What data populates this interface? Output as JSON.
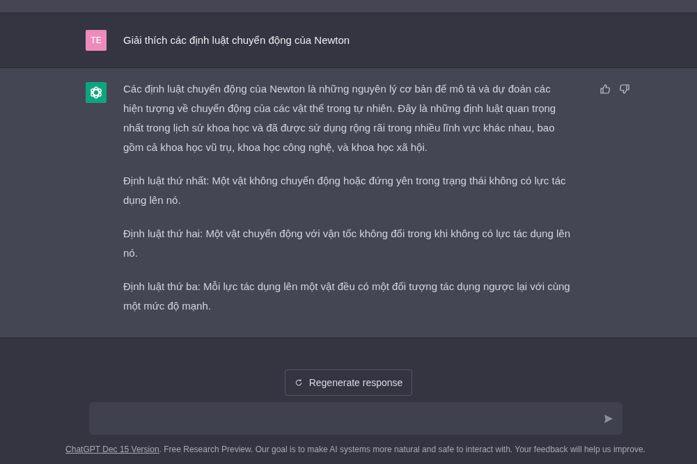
{
  "user_message": {
    "avatar": "TE",
    "text": "Giải thích các định luật chuyển động của Newton"
  },
  "assistant_message": {
    "paragraphs": [
      "Các định luật chuyển động của Newton là những nguyên lý cơ bản để mô tả và dự đoán các hiện tượng về chuyển động của các vật thể trong tự nhiên. Đây là những định luật quan trọng nhất trong lịch sử khoa học và đã được sử dụng rộng rãi trong nhiều lĩnh vực khác nhau, bao gồm cả khoa học vũ trụ, khoa học công nghệ, và khoa học xã hội.",
      "Định luật thứ nhất: Một vật không chuyển động hoặc đứng yên trong trạng thái không có lực tác dụng lên nó.",
      "Định luật thứ hai: Một vật chuyển động với vận tốc không đổi trong khi không có lực tác dụng lên nó.",
      "Định luật thứ ba: Mỗi lực tác dụng lên một vật đều có một đối tượng tác dụng ngược lại với cùng một mức độ mạnh."
    ]
  },
  "regenerate_button": "Regenerate response",
  "footer": {
    "link": "ChatGPT Dec 15 Version",
    "text": ". Free Research Preview. Our goal is to make AI systems more natural and safe to interact with. Your feedback will help us improve."
  }
}
